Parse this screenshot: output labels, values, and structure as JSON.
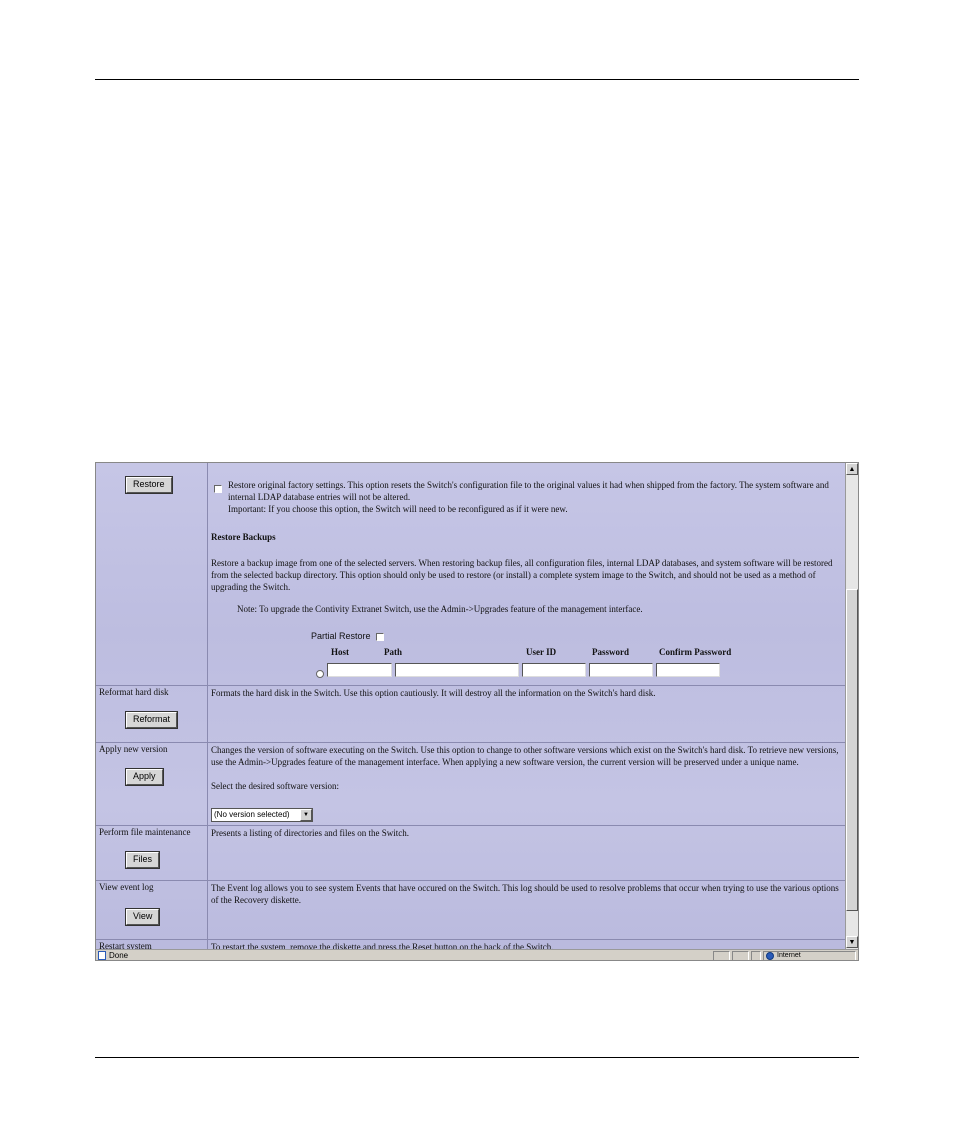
{
  "restore_section": {
    "button_label": "Restore",
    "factory_text": "Restore original factory settings. This option resets the Switch's configuration file to the original values it had when shipped from the factory. The system software and internal LDAP database entries will not be altered.",
    "important_text": "Important: If you choose this option, the Switch will need to be reconfigured as if it were new.",
    "backups_heading": "Restore Backups",
    "backups_text": "Restore a backup image from one of the selected servers. When restoring backup files, all configuration files, internal LDAP databases, and system software will be restored from the selected backup directory. This option should only be used to restore (or install) a complete system image to the Switch, and should not be used as a method of upgrading the Switch.",
    "note_text": "Note: To upgrade the Contivity Extranet Switch, use the Admin->Upgrades feature of the management interface.",
    "partial_restore_label": "Partial Restore",
    "columns": [
      "Host",
      "Path",
      "User ID",
      "Password",
      "Confirm Password"
    ]
  },
  "reformat_section": {
    "title": "Reformat hard disk",
    "button_label": "Reformat",
    "text": "Formats the hard disk in the Switch. Use this option cautiously. It will destroy all the information on the Switch's hard disk."
  },
  "apply_section": {
    "title": "Apply new version",
    "button_label": "Apply",
    "text": "Changes the version of software executing on the Switch. Use this option to change to other software versions which exist on the Switch's hard disk. To retrieve new versions, use the Admin->Upgrades feature of the management interface. When applying a new software version, the current version will be preserved under a unique name.",
    "select_prompt": "Select the desired software version:",
    "select_value": "(No version selected)"
  },
  "files_section": {
    "title": "Perform file maintenance",
    "button_label": "Files",
    "text": "Presents a listing of directories and files on the Switch."
  },
  "view_section": {
    "title": "View event log",
    "button_label": "View",
    "text": "The Event log allows you to see system Events that have occured on the Switch. This log should be used to resolve problems that occur when trying to use the various options of the Recovery diskette."
  },
  "restart_section": {
    "title": "Restart system",
    "text": "To restart the system, remove the diskette and press the Reset button on the back of the Switch."
  },
  "statusbar": {
    "status_text": "Done",
    "zone_text": "Internet"
  },
  "icons": {
    "page": "page-icon",
    "zone": "globe-icon",
    "scroll_up": "arrow-up-icon",
    "scroll_down": "arrow-down-icon",
    "dropdown": "chevron-down-icon"
  }
}
